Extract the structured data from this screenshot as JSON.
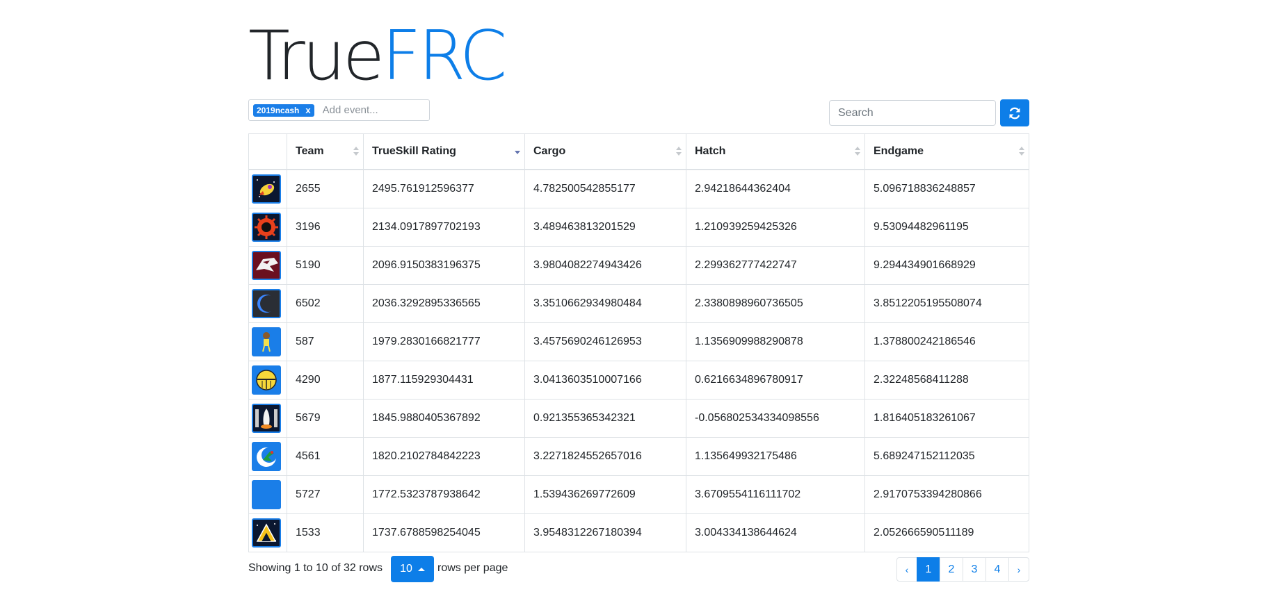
{
  "brand": {
    "part1": "True",
    "part2": "FRC"
  },
  "events": {
    "selected_tag": "2019ncash",
    "remove_label": "x",
    "placeholder": "Add event..."
  },
  "search": {
    "placeholder": "Search"
  },
  "table": {
    "columns": [
      {
        "label": "Team",
        "sort": "none"
      },
      {
        "label": "TrueSkill Rating",
        "sort": "desc"
      },
      {
        "label": "Cargo",
        "sort": "none"
      },
      {
        "label": "Hatch",
        "sort": "none"
      },
      {
        "label": "Endgame",
        "sort": "none"
      }
    ],
    "rows": [
      {
        "logo": "rocket-flame-icon",
        "team": "2655",
        "trueskill": "2495.761912596377",
        "cargo": "4.782500542855177",
        "hatch": "2.94218644362404",
        "endgame": "5.096718836248857"
      },
      {
        "logo": "red-sun-gear-icon",
        "team": "3196",
        "trueskill": "2134.0917897702193",
        "cargo": "3.489463813201529",
        "hatch": "1.210939259425326",
        "endgame": "9.53094482961195"
      },
      {
        "logo": "wolf-head-icon",
        "team": "5190",
        "trueskill": "2096.9150383196375",
        "cargo": "3.9804082274943426",
        "hatch": "2.299362777422747",
        "endgame": "9.294434901668929"
      },
      {
        "logo": "eclipse-moon-icon",
        "team": "6502",
        "trueskill": "2036.3292895336565",
        "cargo": "3.3510662934980484",
        "hatch": "2.3380898960736505",
        "endgame": "3.8512205195508074"
      },
      {
        "logo": "astronaut-icon",
        "team": "587",
        "trueskill": "1979.2830166821777",
        "cargo": "3.4575690246126953",
        "hatch": "1.1356909988290878",
        "endgame": "1.378800242186546"
      },
      {
        "logo": "knight-helmet-icon",
        "team": "4290",
        "trueskill": "1877.115929304431",
        "cargo": "3.0413603510007166",
        "hatch": "0.6216634896780917",
        "endgame": "2.32248568411288"
      },
      {
        "logo": "space-shuttle-icon",
        "team": "5679",
        "trueskill": "1845.9880405367892",
        "cargo": "0.921355365342321",
        "hatch": "-0.056802534334098556",
        "endgame": "1.816405183261067"
      },
      {
        "logo": "crescent-dragon-icon",
        "team": "4561",
        "trueskill": "1820.2102784842223",
        "cargo": "3.2271824552657016",
        "hatch": "1.135649932175486",
        "endgame": "5.689247152112035"
      },
      {
        "logo": "blank-avatar-icon",
        "team": "5727",
        "trueskill": "1772.5323787938642",
        "cargo": "1.539436269772609",
        "hatch": "3.6709554116111702",
        "endgame": "2.9170753394280866"
      },
      {
        "logo": "triforce-icon",
        "team": "1533",
        "trueskill": "1737.6788598254045",
        "cargo": "3.9548312267180394",
        "hatch": "3.004334138644624",
        "endgame": "2.052666590511189"
      }
    ]
  },
  "footer": {
    "showing_text": "Showing 1 to 10 of 32 rows",
    "page_size": "10",
    "rows_per_page_text": "rows per page",
    "pages": [
      "1",
      "2",
      "3",
      "4"
    ],
    "active_page": "1",
    "prev_label": "‹",
    "next_label": "›"
  },
  "colors": {
    "accent": "#0d7ee8",
    "text": "#212529",
    "border": "#dee2e6"
  }
}
